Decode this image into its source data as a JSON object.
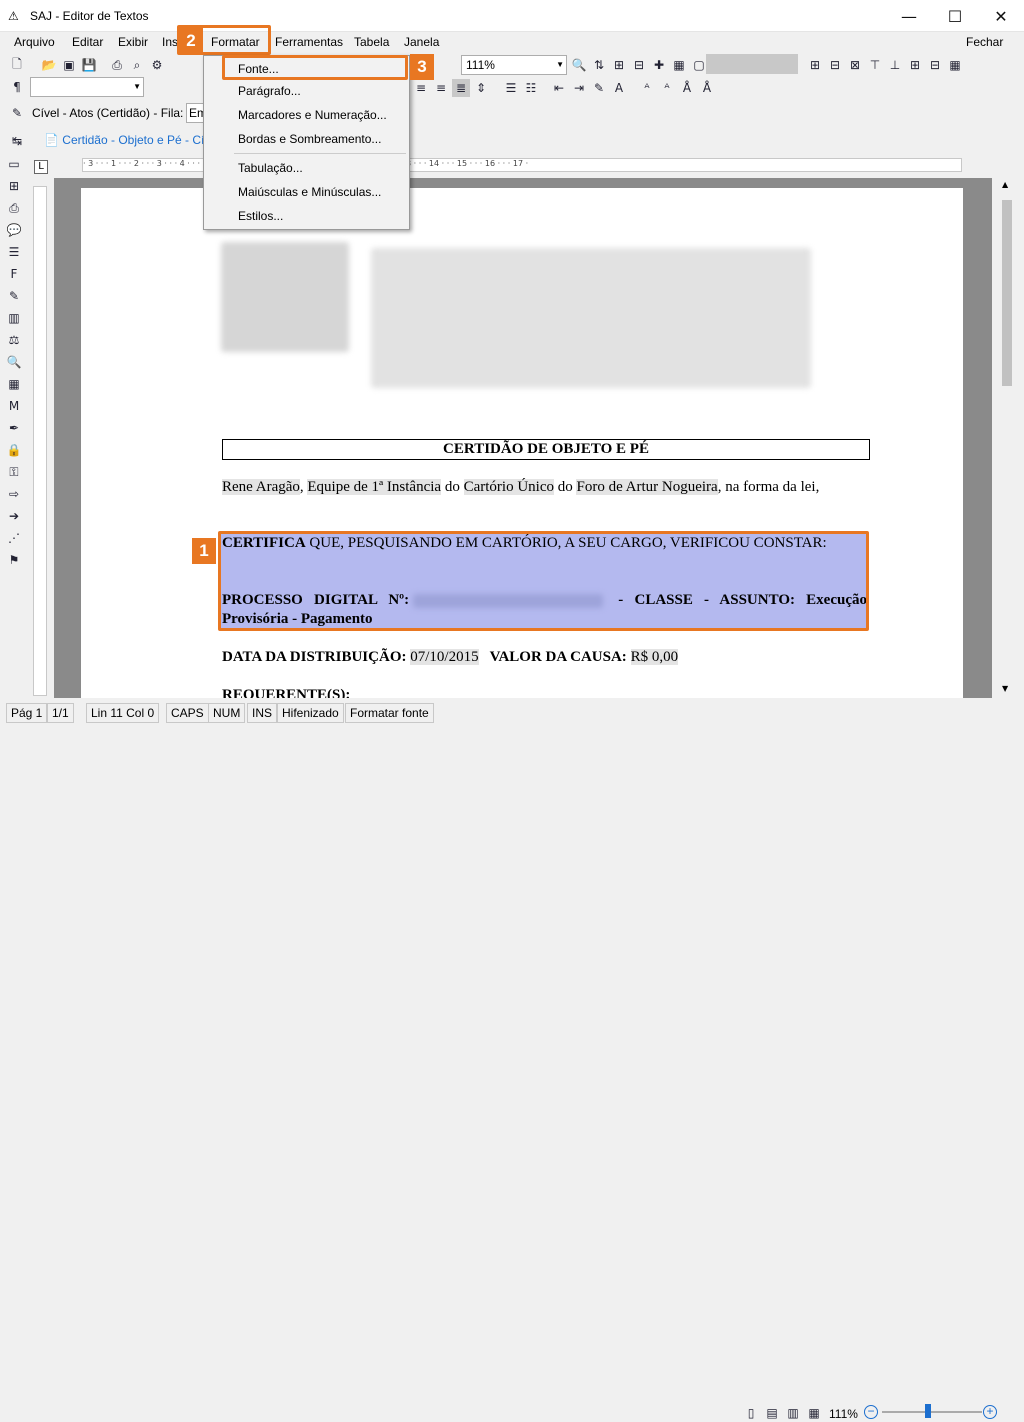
{
  "window": {
    "title": "SAJ - Editor de Textos",
    "close_label": "Fechar"
  },
  "menu": [
    "Arquivo",
    "Editar",
    "Exibir",
    "Ins",
    "Formatar",
    "Ferramentas",
    "Tabela",
    "Janela"
  ],
  "toolbar": {
    "zoom_select": "111%",
    "paragraph_mark": "¶",
    "context_label": "Cível - Atos (Certidão) - Fila:",
    "context_value": "Em",
    "doc_tab": "Certidão - Objeto e Pé - Cíve"
  },
  "dropdown": {
    "items": [
      "Fonte...",
      "Parágrafo...",
      "Marcadores e Numeração...",
      "Bordas e Sombreamento...",
      "Tabulação...",
      "Maiúsculas e Minúsculas...",
      "Estilos..."
    ]
  },
  "badges": [
    "1",
    "2",
    "3"
  ],
  "ruler": "· 3 · · · 1 · · · 2 · · · 3 · · · 4 · · · 5 · · · 6 · · · 7 · · · 8 · · · 9 · · · 10 · · · 11 · · · 12 · · · 13 · · · 14 · · · 15 · · · 16 · · · 17 ·",
  "document": {
    "heading": "CERTIDÃO DE OBJETO E PÉ",
    "intro_parts": [
      "Rene Aragão",
      ", ",
      "Equipe de 1ª Instância",
      " do ",
      "Cartório Único",
      " do ",
      "Foro de Artur Nogueira",
      ", na forma da lei,"
    ],
    "cert_bold": "CERTIFICA",
    "cert_rest": " QUE, PESQUISANDO EM CARTÓRIO, A SEU CARGO, VERIFICOU CONSTAR:",
    "process_label": "PROCESSO DIGITAL Nº:",
    "process_rest": " - CLASSE - ASSUNTO: Execução Provisória - Pagamento",
    "dist_label": "DATA DA DISTRIBUIÇÃO:",
    "dist_value": "07/10/2015",
    "value_label": "VALOR DA CAUSA:",
    "value_value": "R$ 0,00",
    "req_label": "REQUERENTE(S):"
  },
  "status": {
    "page": "Pág 1",
    "pages": "1/1",
    "pos": "Lin 11  Col 0",
    "caps": "CAPS",
    "num": "NUM",
    "ins": "INS",
    "hyph": "Hifenizado",
    "action": "Formatar fonte",
    "zoom": "111%"
  },
  "colors": {
    "accent": "#e87722",
    "selection": "#b4b9ef"
  }
}
